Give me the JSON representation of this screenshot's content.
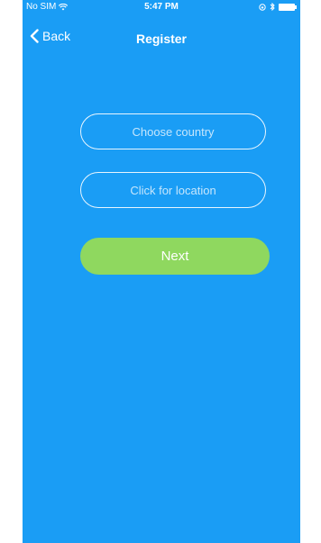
{
  "status_bar": {
    "carrier": "No SIM",
    "time": "5:47 PM"
  },
  "nav": {
    "back_label": "Back",
    "title": "Register"
  },
  "form": {
    "country_placeholder": "Choose country",
    "location_placeholder": "Click for location",
    "next_label": "Next"
  },
  "colors": {
    "background": "#1a9df5",
    "next_button": "#8fd85f",
    "text": "#ffffff"
  },
  "icons": {
    "wifi": "wifi-icon",
    "bluetooth": "bluetooth-icon",
    "battery": "battery-icon",
    "back": "chevron-left-icon"
  }
}
